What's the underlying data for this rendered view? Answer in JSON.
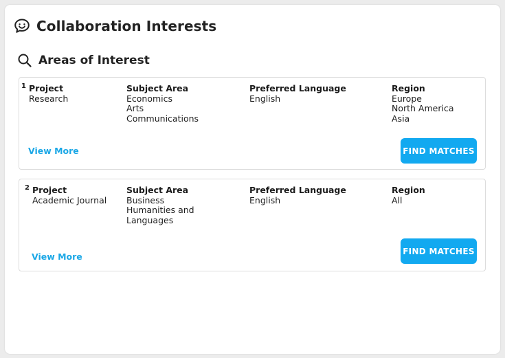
{
  "panel": {
    "title": "Collaboration Interests",
    "title_icon": "chat-smile-icon"
  },
  "section": {
    "title": "Areas of Interest",
    "icon": "search-icon"
  },
  "labels": {
    "project": "Project",
    "subject_area": "Subject Area",
    "preferred_language": "Preferred Language",
    "region": "Region"
  },
  "interests": [
    {
      "number": "1",
      "project": "Research",
      "subject_area": [
        "Economics",
        "Arts",
        "Communications"
      ],
      "preferred_language": "English",
      "region": [
        "Europe",
        "North America",
        "Asia"
      ],
      "view_more": "View More",
      "find_matches": "FIND MATCHES"
    },
    {
      "number": "2",
      "project": "Academic Journal",
      "subject_area": [
        "Business",
        "Humanities and",
        "Languages"
      ],
      "preferred_language": "English",
      "region": [
        "All"
      ],
      "view_more": "View More",
      "find_matches": "FIND MATCHES"
    }
  ],
  "colors": {
    "accent": "#12a9f0",
    "link": "#1aa7e6",
    "background": "#ececec"
  }
}
